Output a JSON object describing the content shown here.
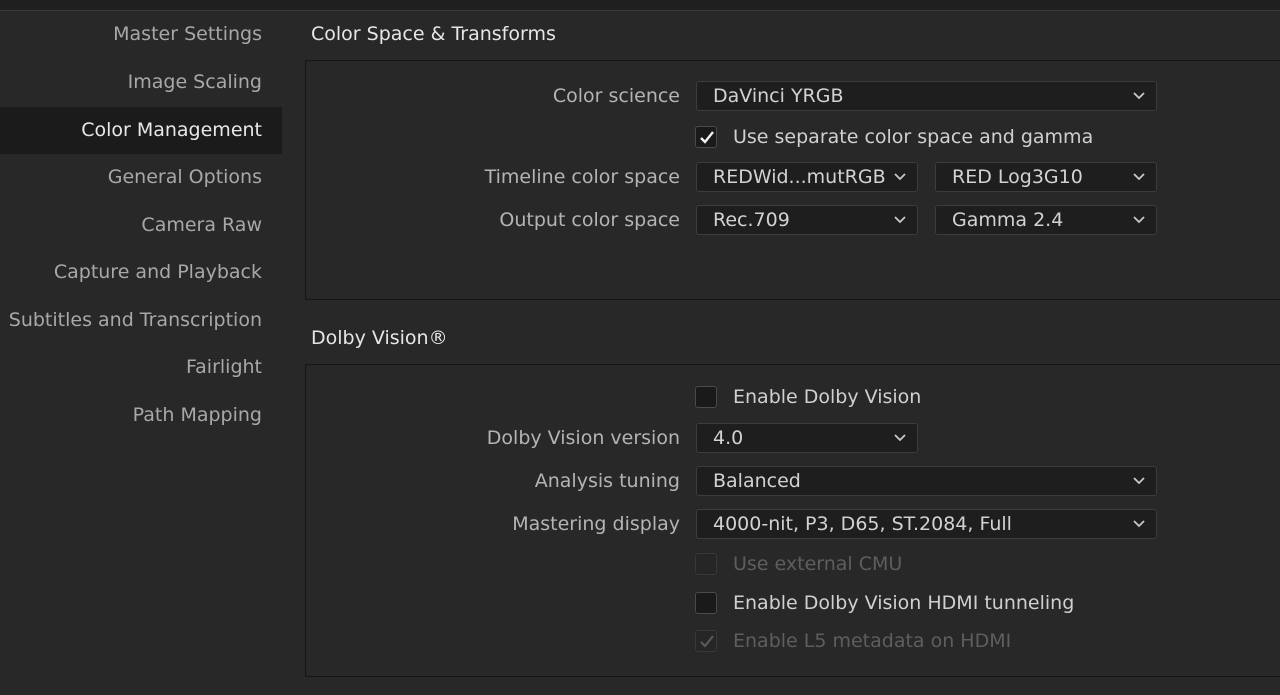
{
  "sidebar": {
    "items": [
      {
        "label": "Master Settings"
      },
      {
        "label": "Image Scaling"
      },
      {
        "label": "Color Management"
      },
      {
        "label": "General Options"
      },
      {
        "label": "Camera Raw"
      },
      {
        "label": "Capture and Playback"
      },
      {
        "label": "Subtitles and Transcription"
      },
      {
        "label": "Fairlight"
      },
      {
        "label": "Path Mapping"
      }
    ],
    "active": "Color Management"
  },
  "color_space": {
    "title": "Color Space & Transforms",
    "color_science_label": "Color science",
    "color_science_value": "DaVinci YRGB",
    "separate_gamma_label": "Use separate color space and gamma",
    "separate_gamma_checked": true,
    "timeline_label": "Timeline color space",
    "timeline_space_value": "REDWid...mutRGB",
    "timeline_gamma_value": "RED Log3G10",
    "output_label": "Output color space",
    "output_space_value": "Rec.709",
    "output_gamma_value": "Gamma 2.4"
  },
  "dolby": {
    "title": "Dolby Vision®",
    "enable_label": "Enable Dolby Vision",
    "enable_checked": false,
    "version_label": "Dolby Vision version",
    "version_value": "4.0",
    "analysis_label": "Analysis tuning",
    "analysis_value": "Balanced",
    "mastering_label": "Mastering display",
    "mastering_value": "4000-nit, P3, D65, ST.2084, Full",
    "external_cmu_label": "Use external CMU",
    "external_cmu_checked": false,
    "external_cmu_enabled": false,
    "hdmi_tunneling_label": "Enable Dolby Vision HDMI tunneling",
    "hdmi_tunneling_checked": false,
    "l5_label": "Enable L5 metadata on HDMI",
    "l5_checked": true,
    "l5_enabled": false
  },
  "colors": {
    "background": "#282828",
    "sidebar_active": "#1b1b1b",
    "field": "#1e1e1e",
    "text": "#c8c8c8"
  },
  "icons": [
    "chevron-down-icon",
    "checkmark-icon"
  ]
}
